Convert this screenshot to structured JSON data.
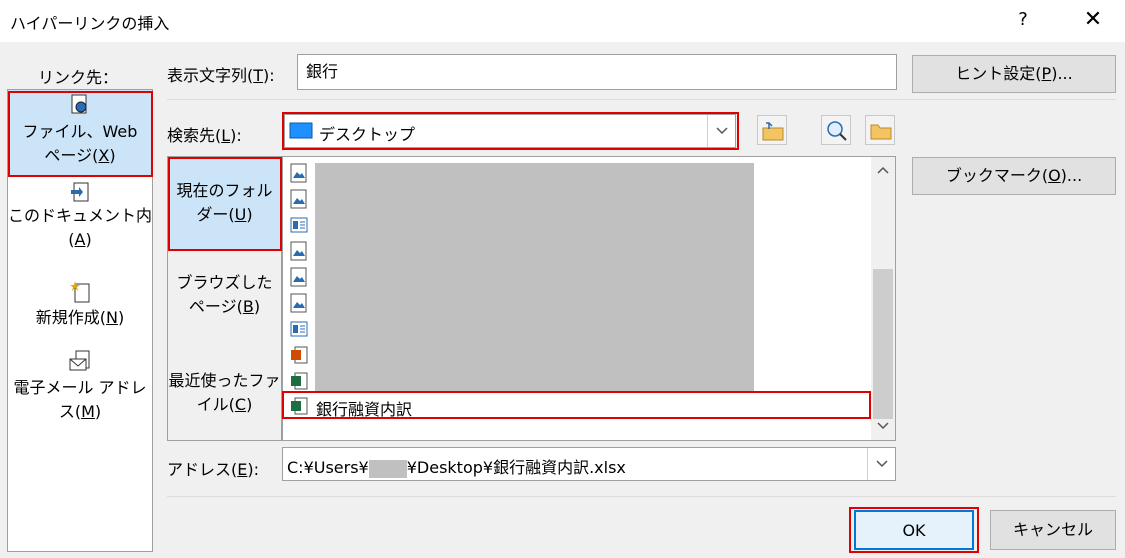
{
  "window": {
    "title": "ハイパーリンクの挿入",
    "help": "?",
    "close": "✕"
  },
  "link_to": {
    "label": "リンク先：",
    "items": [
      {
        "line1": "ファイル、Web",
        "line2_pre": "ページ(",
        "key": "X",
        "post": ")"
      },
      {
        "line1": "このドキュメント内",
        "line2_pre": "(",
        "key": "A",
        "post": ")"
      },
      {
        "line1": "",
        "line2_pre": "新規作成(",
        "key": "N",
        "post": ")"
      },
      {
        "line1": "電子メール アドレ",
        "line2_pre": "ス(",
        "key": "M",
        "post": ")"
      }
    ]
  },
  "display_text": {
    "label_pre": "表示文字列(",
    "key": "T",
    "label_post": "):",
    "value": "銀行"
  },
  "screentip": {
    "label_pre": "ヒント設定(",
    "key": "P",
    "label_post": ")..."
  },
  "look_in": {
    "label_pre": "検索先(",
    "key": "L",
    "label_post": "):",
    "value": "デスクトップ"
  },
  "bookmark": {
    "label_pre": "ブックマーク(",
    "key": "O",
    "label_post": ")..."
  },
  "nav": [
    {
      "line1": "現在のフォル",
      "line2_pre": "ダー(",
      "key": "U",
      "post": ")"
    },
    {
      "line1": "ブラウズした",
      "line2_pre": "ページ(",
      "key": "B",
      "post": ")"
    },
    {
      "line1": "最近使ったファ",
      "line2_pre": "イル(",
      "key": "C",
      "post": ")"
    }
  ],
  "files": {
    "selected_name": "銀行融資内訳"
  },
  "address": {
    "label_pre": "アドレス(",
    "key": "E",
    "label_post": "):",
    "value_pre": "C:¥Users¥",
    "value_post": "¥Desktop¥銀行融資内訳.xlsx"
  },
  "buttons": {
    "ok": "OK",
    "cancel": "キャンセル"
  },
  "colors": {
    "highlight": "#cce4f7",
    "annotation_red": "#e00000",
    "redacted": "#c0c0c0"
  }
}
